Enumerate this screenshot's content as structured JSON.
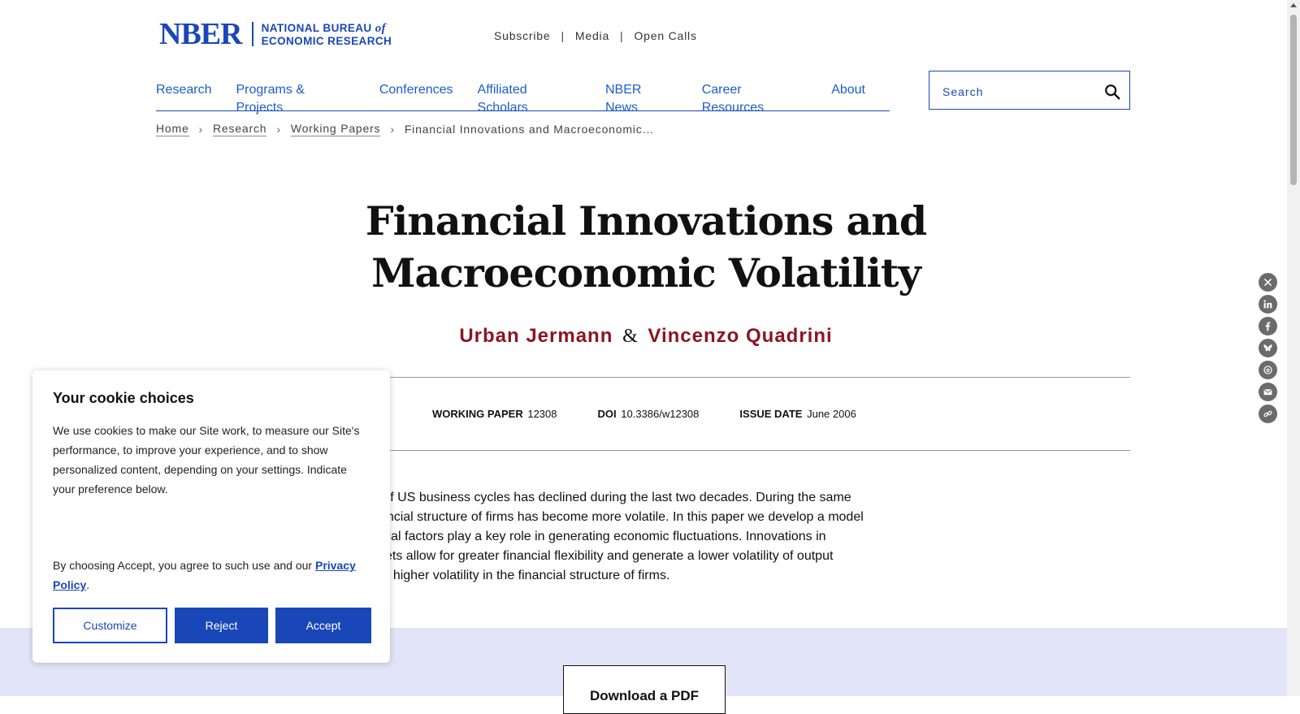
{
  "logo": {
    "mark": "NBER",
    "line1": "NATIONAL BUREAU",
    "line1_of": "of",
    "line2": "ECONOMIC RESEARCH"
  },
  "top_links": [
    "Subscribe",
    "Media",
    "Open Calls"
  ],
  "top_links_separator": "|",
  "nav": [
    "Research",
    "Programs & Projects",
    "Conferences",
    "Affiliated Scholars",
    "NBER News",
    "Career Resources",
    "About"
  ],
  "search": {
    "placeholder": "Search",
    "value": ""
  },
  "breadcrumb": {
    "items": [
      "Home",
      "Research",
      "Working Papers"
    ],
    "current": "Financial Innovations and Macroeconomic…",
    "separator": "›"
  },
  "paper": {
    "title": "Financial Innovations and Macroeconomic Volatility",
    "authors": [
      "Urban Jermann",
      "Vincenzo Quadrini"
    ],
    "author_join": "&",
    "meta": [
      {
        "label": "WORKING PAPER",
        "value": "12308"
      },
      {
        "label": "DOI",
        "value": "10.3386/w12308"
      },
      {
        "label": "ISSUE DATE",
        "value": "June 2006"
      }
    ],
    "abstract_lines": [
      "volatility of US business cycles has declined during the last two decades. During the same",
      "d the financial structure of firms has become more volatile. In this paper we develop a model",
      "ich financial factors play a key role in generating economic fluctuations. Innovations in",
      "cial markets allow for greater financial flexibility and generate a lower volatility of output",
      "her with a higher volatility in the financial structure of firms."
    ],
    "download_label": "Download a PDF"
  },
  "share_icons": [
    "x-icon",
    "linkedin-icon",
    "facebook-icon",
    "bluesky-icon",
    "threads-icon",
    "email-icon",
    "link-icon"
  ],
  "cookie": {
    "title": "Your cookie choices",
    "body": "We use cookies to make our Site work, to measure our Site's performance, to improve your experience, and to show personalized content, depending on your settings. Indicate your preference below.",
    "accept_text_before": "By choosing Accept, you agree to such use and our ",
    "privacy_link": "Privacy Policy",
    "accept_text_after": ".",
    "buttons": {
      "customize": "Customize",
      "reject": "Reject",
      "accept": "Accept"
    }
  },
  "colors": {
    "brand_blue": "#1a47b8",
    "link_blue": "#1a5ec7",
    "author_red": "#8b1520",
    "band_lavender": "#e1e5f7"
  }
}
